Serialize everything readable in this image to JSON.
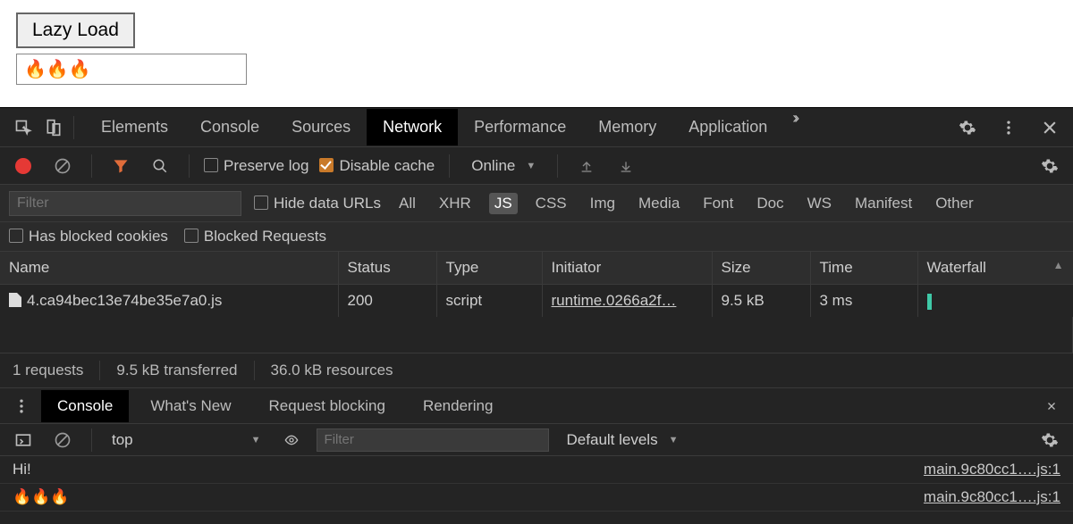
{
  "page": {
    "button_label": "Lazy Load",
    "output": "🔥🔥🔥"
  },
  "devtools": {
    "tabs": [
      "Elements",
      "Console",
      "Sources",
      "Network",
      "Performance",
      "Memory",
      "Application"
    ],
    "active_tab": "Network",
    "toolbar": {
      "preserve_log": "Preserve log",
      "disable_cache": "Disable cache",
      "throttle": "Online"
    },
    "filters": {
      "placeholder": "Filter",
      "hide_data_urls": "Hide data URLs",
      "types": [
        "All",
        "XHR",
        "JS",
        "CSS",
        "Img",
        "Media",
        "Font",
        "Doc",
        "WS",
        "Manifest",
        "Other"
      ],
      "selected_type": "JS",
      "has_blocked": "Has blocked cookies",
      "blocked_req": "Blocked Requests"
    },
    "table": {
      "headers": {
        "name": "Name",
        "status": "Status",
        "type": "Type",
        "initiator": "Initiator",
        "size": "Size",
        "time": "Time",
        "waterfall": "Waterfall"
      },
      "rows": [
        {
          "name": "4.ca94bec13e74be35e7a0.js",
          "status": "200",
          "type": "script",
          "initiator": "runtime.0266a2f…",
          "size": "9.5 kB",
          "time": "3 ms"
        }
      ]
    },
    "summary": {
      "requests": "1 requests",
      "transferred": "9.5 kB transferred",
      "resources": "36.0 kB resources"
    },
    "drawer": {
      "tabs": [
        "Console",
        "What's New",
        "Request blocking",
        "Rendering"
      ],
      "active": "Console",
      "context": "top",
      "filter_placeholder": "Filter",
      "levels": "Default levels",
      "logs": [
        {
          "msg": "Hi!",
          "src": "main.9c80cc1….js:1"
        },
        {
          "msg": "🔥🔥🔥",
          "src": "main.9c80cc1….js:1"
        }
      ]
    }
  }
}
